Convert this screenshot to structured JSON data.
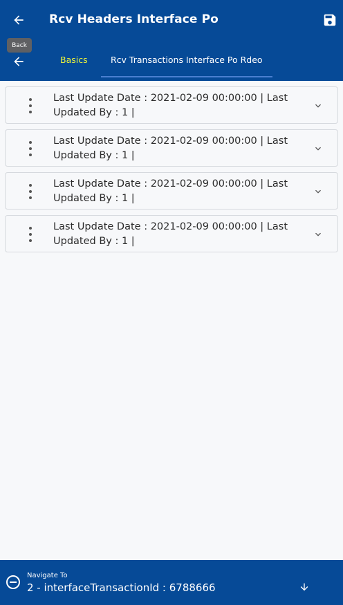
{
  "header": {
    "title": "Rcv Headers Interface Po",
    "back_tooltip": "Back",
    "icons": {
      "back": "arrow-left-icon",
      "save": "save-icon"
    }
  },
  "tabs": [
    {
      "label": "Basics"
    },
    {
      "label": "Rcv Transactions Interface Po Rdeo"
    }
  ],
  "records": [
    {
      "line1": "Last Update Date  : 2021-02-09 00:00:00 | Last",
      "line2": "Updated By  : 1 |"
    },
    {
      "line1": "Last Update Date  : 2021-02-09 00:00:00 | Last",
      "line2": "Updated By  : 1 |"
    },
    {
      "line1": "Last Update Date  : 2021-02-09 00:00:00 | Last",
      "line2": "Updated By  : 1 |"
    },
    {
      "line1": "Last Update Date  : 2021-02-09 00:00:00 | Last",
      "line2": "Updated By  : 1 |"
    }
  ],
  "footer": {
    "navigate_label": "Navigate To",
    "navigate_value": "2 - interfaceTransactionId : 6788666"
  },
  "colors": {
    "primary": "#064a97",
    "active_tab": "#e8f23a"
  }
}
